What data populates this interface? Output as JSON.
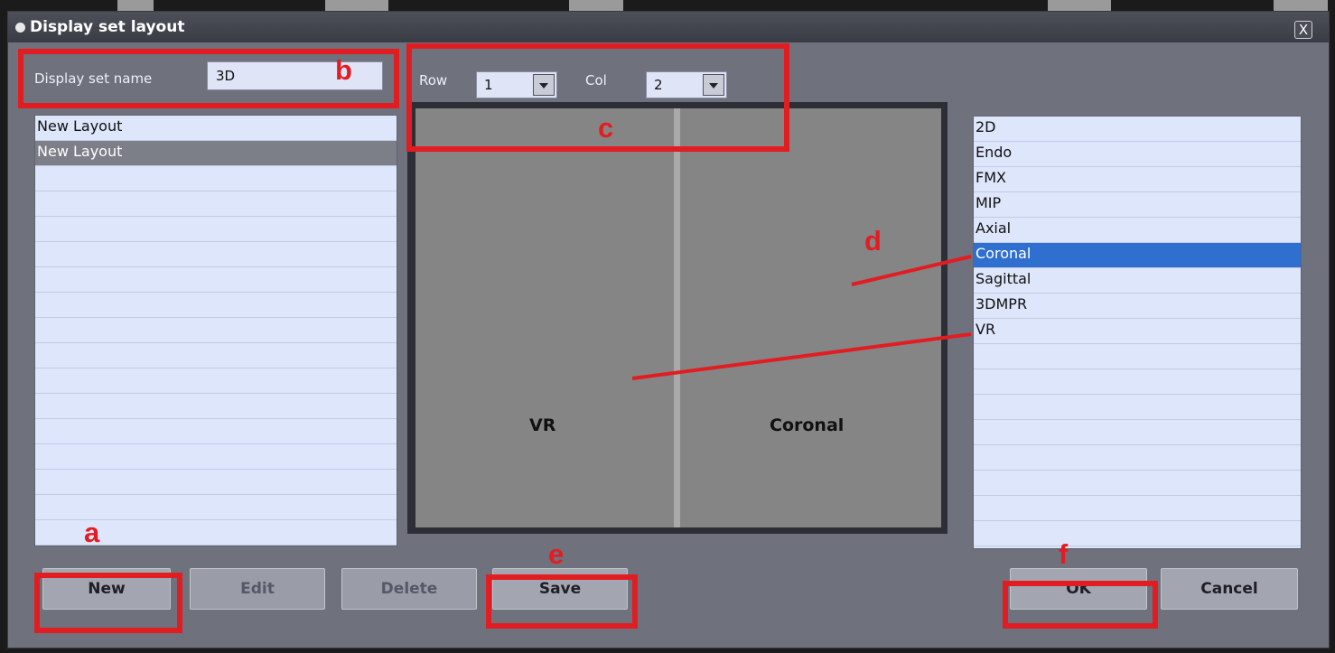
{
  "window": {
    "title": "Display set layout",
    "close_label": "X"
  },
  "form": {
    "display_set_name_label": "Display set name",
    "display_set_name_value": "3D",
    "row_label": "Row",
    "row_value": "1",
    "col_label": "Col",
    "col_value": "2"
  },
  "layout_list": {
    "items": [
      "New Layout",
      "New Layout"
    ],
    "selected_index": 1
  },
  "preview": {
    "panes": [
      "VR",
      "Coronal"
    ]
  },
  "view_list": {
    "items": [
      "2D",
      "Endo",
      "FMX",
      "MIP",
      "Axial",
      "Coronal",
      "Sagittal",
      "3DMPR",
      "VR"
    ],
    "selected_index": 5
  },
  "buttons": {
    "new": "New",
    "edit": "Edit",
    "delete": "Delete",
    "save": "Save",
    "ok": "OK",
    "cancel": "Cancel"
  },
  "annotations": {
    "a": "a",
    "b": "b",
    "c": "c",
    "d": "d",
    "e": "e",
    "f": "f",
    "color": "#e21d22"
  },
  "colors": {
    "dialog_bg": "#6f717d",
    "list_bg": "#dde6fb",
    "selection": "#2f6fd0",
    "pane_gray": "#858585"
  }
}
